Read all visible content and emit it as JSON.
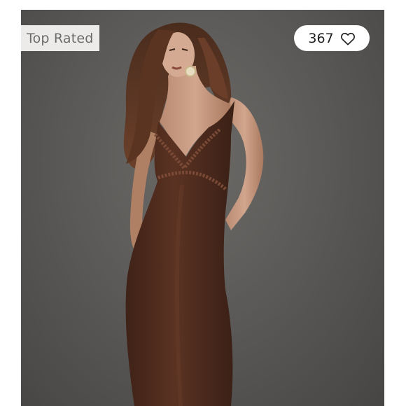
{
  "product_card": {
    "badge_label": "Top Rated",
    "like_count": "367",
    "like_icon": "heart-outline-icon",
    "image_subject": "model-in-brown-lace-trim-slip-dress"
  },
  "colors": {
    "badge_background": "#ecebea",
    "badge_text": "#6c6c6c",
    "pill_background": "#ffffff",
    "backdrop": "#5e5c5a",
    "dress": "#4e2b1d"
  }
}
